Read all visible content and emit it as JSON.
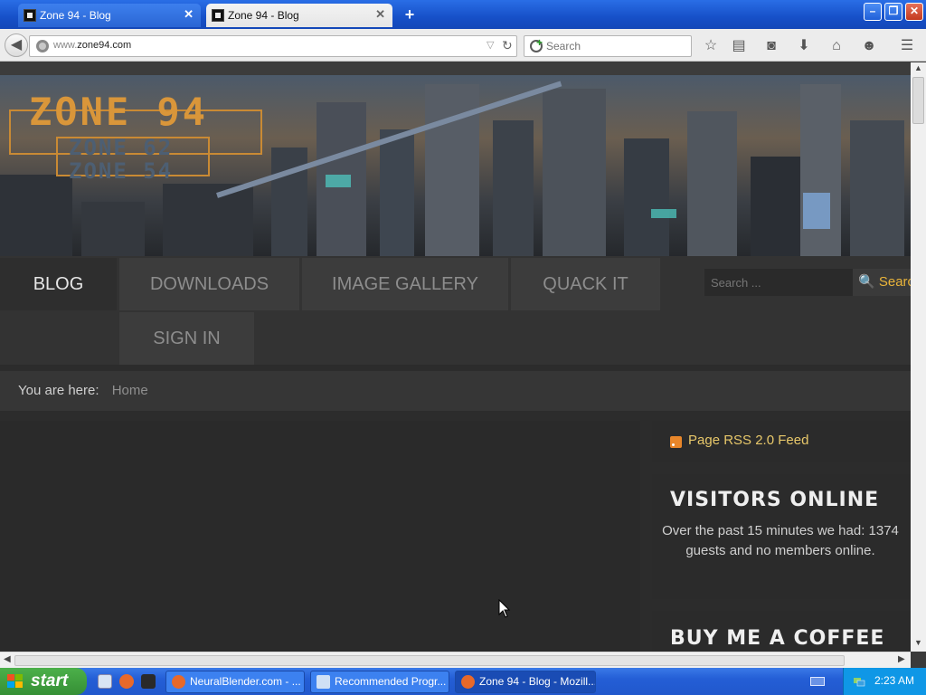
{
  "browser": {
    "tabs": [
      {
        "title": "Zone 94 - Blog",
        "active": false
      },
      {
        "title": "Zone 94 - Blog",
        "active": true
      }
    ],
    "new_tab_label": "+",
    "window_controls": {
      "minimize": "–",
      "restore": "❐",
      "close": "✕"
    },
    "url_prefix": "www.",
    "url_host": "zone94.com",
    "search_placeholder": "Search",
    "toolbar_icons": [
      "bookmark-star-icon",
      "reading-list-icon",
      "pocket-icon",
      "download-icon",
      "home-icon",
      "chat-icon",
      "menu-icon"
    ]
  },
  "site": {
    "logo": {
      "main": "ZONE 94",
      "sub1": "ZONE 62",
      "sub2": "ZONE 54"
    },
    "nav": [
      {
        "label": "BLOG",
        "active": true
      },
      {
        "label": "DOWNLOADS",
        "active": false
      },
      {
        "label": "IMAGE GALLERY",
        "active": false
      },
      {
        "label": "QUACK IT",
        "active": false
      },
      {
        "label": "SIGN IN",
        "active": false
      }
    ],
    "search": {
      "placeholder": "Search ...",
      "button": "Search"
    },
    "breadcrumb": {
      "lead": "You are here:",
      "current": "Home"
    },
    "sidebar": {
      "rss_label": "Page RSS 2.0 Feed",
      "visitors_title": "VISITORS ONLINE",
      "visitors_text": "Over the past 15 minutes we had: 1374 guests and no members online.",
      "coffee_title": "BUY ME A COFFEE"
    },
    "accent_color": "#e9b43a"
  },
  "taskbar": {
    "start_label": "start",
    "tasks": [
      {
        "label": "NeuralBlender.com - ...",
        "active": false
      },
      {
        "label": "Recommended Progr...",
        "active": false
      },
      {
        "label": "Zone 94 - Blog - Mozill...",
        "active": true
      }
    ],
    "clock": "2:23 AM"
  }
}
